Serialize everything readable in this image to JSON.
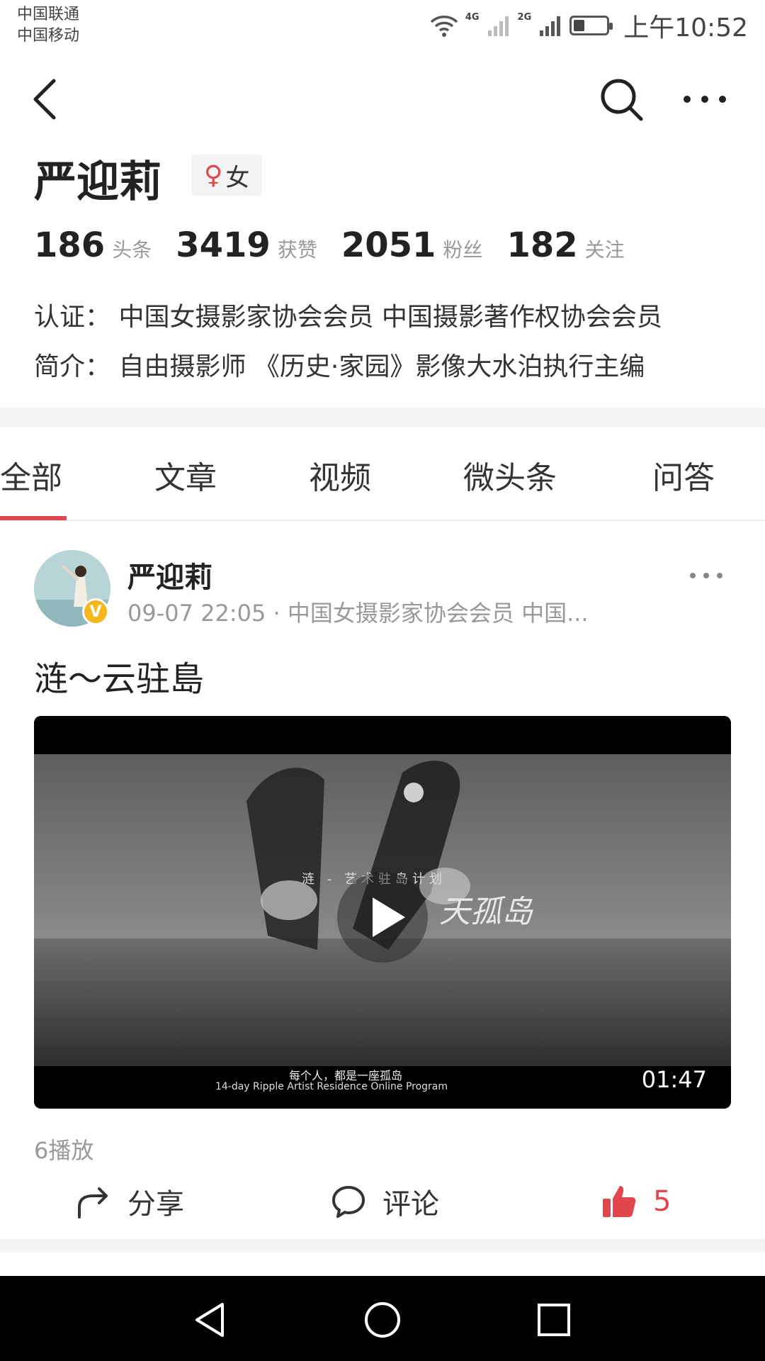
{
  "status_bar": {
    "carrier_1": "中国联通",
    "carrier_2": "中国移动",
    "net_1": "4G",
    "net_2": "2G",
    "battery_level": 0.35,
    "time": "上午10:52"
  },
  "profile": {
    "name": "严迎莉",
    "gender_symbol": "♀",
    "gender": "女",
    "stats": [
      {
        "value": "186",
        "label": "头条"
      },
      {
        "value": "3419",
        "label": "获赞"
      },
      {
        "value": "2051",
        "label": "粉丝"
      },
      {
        "value": "182",
        "label": "关注"
      }
    ],
    "certification_label": "认证：",
    "certification": "中国女摄影家协会会员 中国摄影著作权协会会员",
    "intro_label": "简介：",
    "intro": "自由摄影师 《历史·家园》影像大水泊执行主编"
  },
  "tabs": [
    {
      "label": "全部",
      "active": true
    },
    {
      "label": "文章",
      "active": false
    },
    {
      "label": "视频",
      "active": false
    },
    {
      "label": "微头条",
      "active": false
    },
    {
      "label": "问答",
      "active": false
    }
  ],
  "post": {
    "author": "严迎莉",
    "badge": "V",
    "meta": "09-07 22:05 · 中国女摄影家协会会员 中国...",
    "title": "涟～云驻島",
    "video": {
      "overlay_caption": "涟 - 艺术驻岛计划",
      "overlay_handwriting": "天孤岛",
      "tagline": "每个人，都是一座孤岛",
      "subtitle": "14-day Ripple Artist Residence Online Program",
      "duration": "01:47"
    },
    "play_count": "6播放",
    "actions": {
      "share": "分享",
      "comment": "评论",
      "like_count": "5"
    }
  },
  "colors": {
    "accent": "#e0464b",
    "badge": "#f4b71e",
    "muted": "#999999"
  }
}
